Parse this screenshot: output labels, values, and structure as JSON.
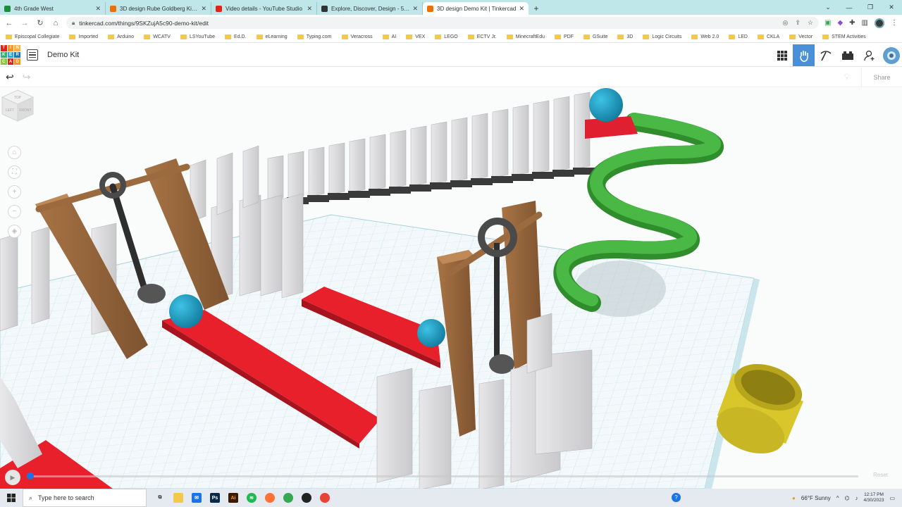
{
  "browser": {
    "tabs": [
      {
        "title": "4th Grade West",
        "favicon_color": "#1e8e3e"
      },
      {
        "title": "3D design Rube Goldberg Kit | Ti",
        "favicon_color": "#e8710a"
      },
      {
        "title": "Video details - YouTube Studio",
        "favicon_color": "#e62117"
      },
      {
        "title": "Explore, Discover, Design - 5th G",
        "favicon_color": "#333333"
      },
      {
        "title": "3D design Demo Kit | Tinkercad",
        "favicon_color": "#e8710a"
      }
    ],
    "url": "tinkercad.com/things/9SKZujA5c90-demo-kit/edit",
    "bookmarks": [
      "Episcopal Collegiate",
      "Imported",
      "Arduino",
      "WCATV",
      "LSYouTube",
      "Ed.D.",
      "eLearning",
      "Typing.com",
      "Veracross",
      "AI",
      "VEX",
      "LEGO",
      "ECTV Jr.",
      "MinecraftEdu",
      "PDF",
      "GSuite",
      "3D",
      "Logic Circuits",
      "Web 2.0",
      "LED",
      "CKLA",
      "Vector",
      "STEM Activities"
    ]
  },
  "tinkercad": {
    "logo_letters": [
      "T",
      "I",
      "N",
      "K",
      "E",
      "R",
      "C",
      "A",
      "D"
    ],
    "logo_colors": [
      "#e2231a",
      "#f7941d",
      "#fbb040",
      "#2bb673",
      "#27aae1",
      "#1c75bc",
      "#8dc63f",
      "#e2231a",
      "#f7941d"
    ],
    "design_name": "Demo Kit",
    "share_label": "Share",
    "reset_label": "Reset",
    "viewcube": {
      "top": "TOP",
      "left": "LEFT",
      "front": "FRONT"
    }
  },
  "taskbar": {
    "search_placeholder": "Type here to search",
    "weather": "66°F  Sunny",
    "time": "12:17 PM",
    "date": "4/30/2023"
  },
  "colors": {
    "grid": "#d2e8ee",
    "red_ramp": "#e8202c",
    "brown_post": "#9b6b3f",
    "green_spiral": "#3da93a",
    "blue_ball": "#1b9bc2",
    "yellow_cup": "#d9c62b"
  }
}
